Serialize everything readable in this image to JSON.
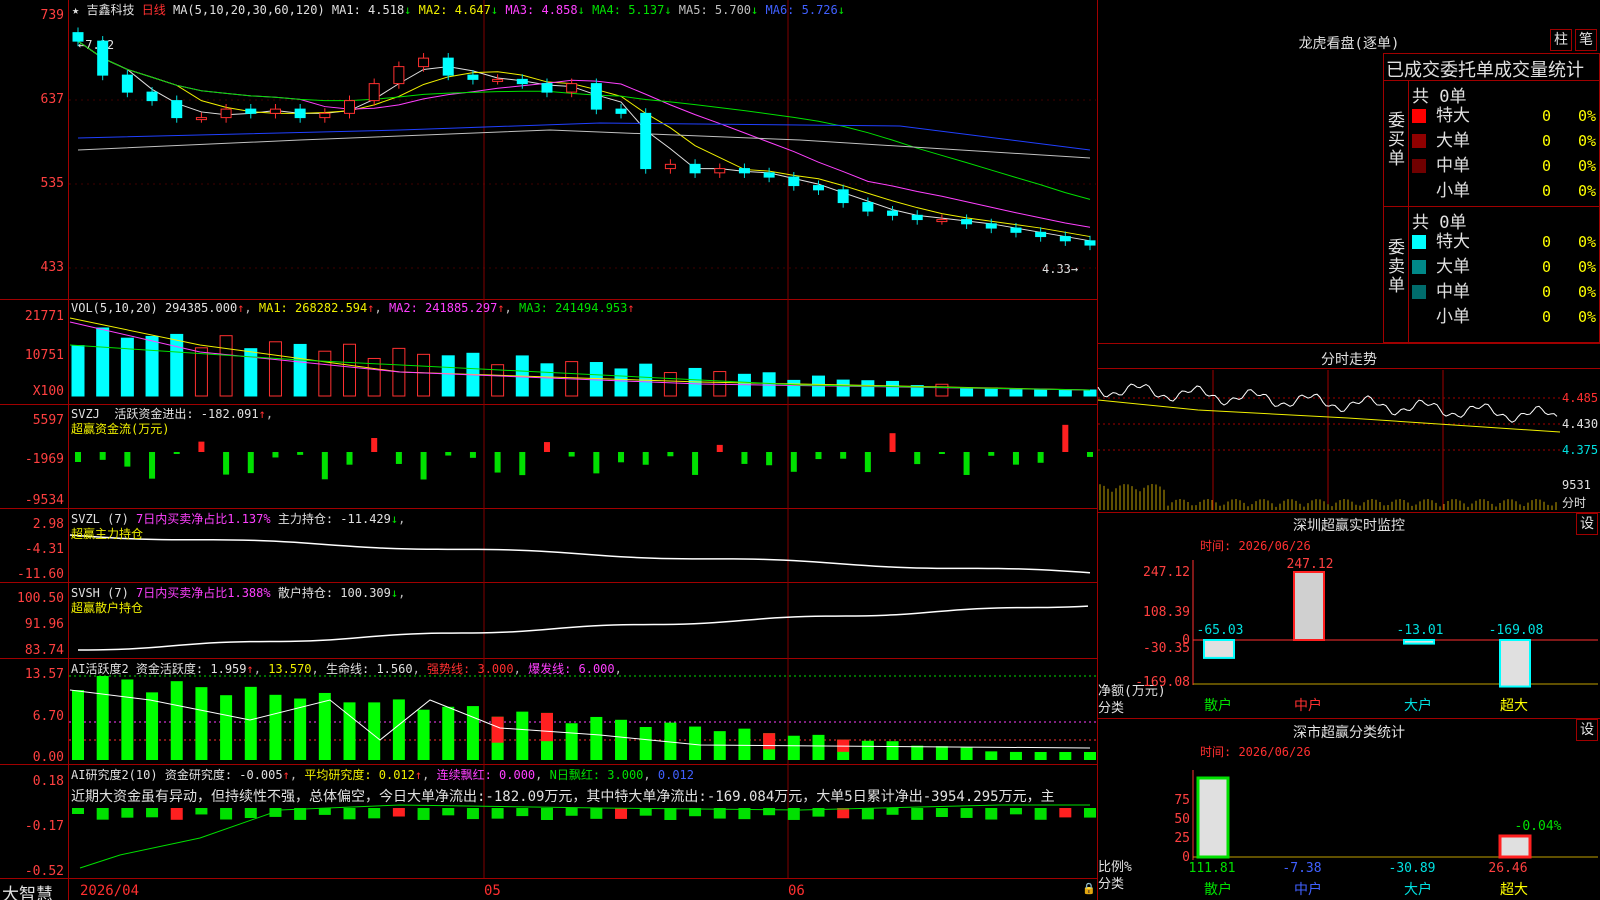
{
  "stock_name": "吉鑫科技",
  "period": "日线",
  "star": "★",
  "ma_header": "MA(5,10,20,30,60,120)",
  "ma": [
    {
      "label": "MA1:",
      "value": "4.518",
      "arrow": "↓",
      "color": "#e0e0e0"
    },
    {
      "label": "MA2:",
      "value": "4.647",
      "arrow": "↓",
      "color": "#f0f000"
    },
    {
      "label": "MA3:",
      "value": "4.858",
      "arrow": "↓",
      "color": "#ff40ff"
    },
    {
      "label": "MA4:",
      "value": "5.137",
      "arrow": "↓",
      "color": "#00e000"
    },
    {
      "label": "MA5:",
      "value": "5.700",
      "arrow": "↓",
      "color": "#c0c0c0"
    },
    {
      "label": "MA6:",
      "value": "5.726",
      "arrow": "↓",
      "color": "#4060ff"
    }
  ],
  "price_axis": [
    "739",
    "637",
    "535",
    "433"
  ],
  "price_high_label": "7.12",
  "price_low_label": "4.33",
  "vol_axis": [
    "21771",
    "10751",
    "X100"
  ],
  "vol_header": {
    "name": "VOL(5,10,20)",
    "value": "294385.000",
    "ma1": "MA1: 268282.594",
    "ma2": "MA2: 241885.297",
    "ma3": "MA3: 241494.953",
    "arrow": "↑"
  },
  "svzj_axis": [
    "5597",
    "-1969",
    "-9534"
  ],
  "svzj_header": {
    "name": "SVZJ",
    "label": "活跃资金进出: -182.091",
    "arrow": "↑",
    "sub": "超赢资金流(万元)"
  },
  "svzl_axis": [
    "2.98",
    "-4.31",
    "-11.60"
  ],
  "svzl_header": {
    "name": "SVZL (7)",
    "ratio": "7日内买卖净占比1.137%",
    "label": "主力持仓: -11.429",
    "arrow": "↓",
    "sub": "超赢主力持仓"
  },
  "svsh_axis": [
    "100.50",
    "91.96",
    "83.74"
  ],
  "svsh_header": {
    "name": "SVSH (7)",
    "ratio": "7日内买卖净占比1.388%",
    "label": "散户持仓: 100.309",
    "arrow": "↓",
    "sub": "超赢散户持仓"
  },
  "ai1_axis": [
    "13.57",
    "6.70",
    "0.00"
  ],
  "ai1_header": {
    "name": "AI活跃度2",
    "l1": "资金活跃度: 1.959",
    "a1": "↑",
    "l2": "13.570",
    "l3": "生命线: 1.560",
    "l4": "强势线: 3.000",
    "l5": "爆发线: 6.000"
  },
  "ai2_axis": [
    "0.18",
    "-0.17",
    "-0.52"
  ],
  "ai2_header": {
    "name": "AI研究度2(10)",
    "l1": "资金研究度: -0.005",
    "a1": "↑",
    "l2": "平均研究度: 0.012",
    "a2": "↑",
    "l3": "连续飘红: 0.000",
    "l4": "N日飘红: 3.000",
    "l5": "0.012"
  },
  "ai2_comment": "近期大资金虽有异动，但持续性不强，总体偏空，今日大单净流出:-182.09万元，其中特大单净流出:-169.084万元，大单5日累计净出-3954.295万元，主",
  "x_axis": {
    "brand": "大智慧",
    "d1": "2026/04",
    "d2": "05",
    "d3": "06"
  },
  "right": {
    "lhb_title": "龙虎看盘(逐单)",
    "btn1": "柱",
    "btn2": "笔",
    "table_title": "已成交委托单成交量统计",
    "buy": {
      "side": "委买单",
      "total": "共 0单",
      "rows": [
        {
          "name": "特大",
          "v": "0",
          "p": "0%",
          "color": "#ff0000"
        },
        {
          "name": "大单",
          "v": "0",
          "p": "0%",
          "color": "#900000"
        },
        {
          "name": "中单",
          "v": "0",
          "p": "0%",
          "color": "#700000"
        },
        {
          "name": "小单",
          "v": "0",
          "p": "0%",
          "color": ""
        }
      ]
    },
    "sell": {
      "side": "委卖单",
      "total": "共 0单",
      "rows": [
        {
          "name": "特大",
          "v": "0",
          "p": "0%",
          "color": "#00ffff"
        },
        {
          "name": "大单",
          "v": "0",
          "p": "0%",
          "color": "#008888"
        },
        {
          "name": "中单",
          "v": "0",
          "p": "0%",
          "color": "#006c6c"
        },
        {
          "name": "小单",
          "v": "0",
          "p": "0%",
          "color": ""
        }
      ]
    },
    "fenshi_title": "分时走势",
    "fenshi_axis": [
      "4.485",
      "4.430",
      "4.375",
      "9531",
      "分时"
    ],
    "sz_title": "深圳超赢实时监控",
    "set_btn": "设",
    "sz_time": "时间: 2026/06/26",
    "sz_axis": [
      "247.12",
      "108.39",
      "0",
      "-30.35",
      "-169.08"
    ],
    "sz_ylabel": "净额(万元)",
    "sz_xlabel": "分类",
    "sz_cats": [
      "散户",
      "中户",
      "大户",
      "超大"
    ],
    "sz_values": [
      "-65.03",
      "247.12",
      "-13.01",
      "-169.08"
    ],
    "fl_title": "深市超赢分类统计",
    "fl_time": "时间: 2026/06/26",
    "fl_axis": [
      "75",
      "50",
      "25",
      "0"
    ],
    "fl_ylabel": "比例%",
    "fl_xlabel": "分类",
    "fl_bottom": [
      "111.81",
      "-7.38",
      "-30.89",
      "26.46"
    ],
    "fl_top_label": "-0.04%"
  },
  "chart_data": {
    "type": "candlestick",
    "title": "",
    "ylim": [
      4.33,
      7.39
    ],
    "candles_close": [
      7.0,
      6.6,
      6.4,
      6.3,
      6.1,
      6.1,
      6.2,
      6.15,
      6.2,
      6.1,
      6.15,
      6.3,
      6.5,
      6.7,
      6.8,
      6.6,
      6.55,
      6.55,
      6.5,
      6.4,
      6.5,
      6.2,
      6.15,
      5.5,
      5.55,
      5.45,
      5.5,
      5.45,
      5.4,
      5.3,
      5.25,
      5.1,
      5.0,
      4.95,
      4.9,
      4.9,
      4.85,
      4.8,
      4.75,
      4.7,
      4.65,
      4.6
    ]
  }
}
